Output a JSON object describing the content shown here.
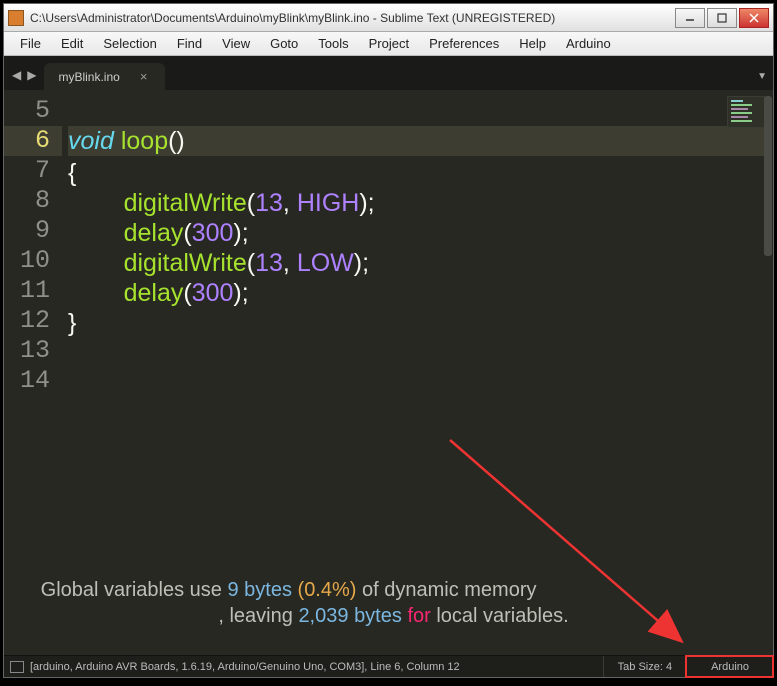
{
  "titlebar": {
    "path": "C:\\Users\\Administrator\\Documents\\Arduino\\myBlink\\myBlink.ino - Sublime Text (UNREGISTERED)"
  },
  "menu": [
    "File",
    "Edit",
    "Selection",
    "Find",
    "View",
    "Goto",
    "Tools",
    "Project",
    "Preferences",
    "Help",
    "Arduino"
  ],
  "tab": {
    "name": "myBlink.ino"
  },
  "lines": {
    "start": 5,
    "active": 6,
    "rows": [
      {
        "n": "5",
        "html": ""
      },
      {
        "n": "6",
        "html": "<span class='kw'>void</span> <span class='fn'>loop</span><span class='punct'>()</span>"
      },
      {
        "n": "7",
        "html": "<span class='punct'>{</span>"
      },
      {
        "n": "8",
        "html": "        <span class='fn'>digitalWrite</span><span class='punct'>(</span><span class='num'>13</span><span class='punct'>, </span><span class='const'>HIGH</span><span class='punct'>);</span>"
      },
      {
        "n": "9",
        "html": "        <span class='fn'>delay</span><span class='punct'>(</span><span class='num'>300</span><span class='punct'>);</span>"
      },
      {
        "n": "10",
        "html": "        <span class='fn'>digitalWrite</span><span class='punct'>(</span><span class='num'>13</span><span class='punct'>, </span><span class='const'>LOW</span><span class='punct'>);</span>"
      },
      {
        "n": "11",
        "html": "        <span class='fn'>delay</span><span class='punct'>(</span><span class='num'>300</span><span class='punct'>);</span>"
      },
      {
        "n": "12",
        "html": "<span class='punct'>}</span>"
      },
      {
        "n": "13",
        "html": ""
      },
      {
        "n": "14",
        "html": ""
      }
    ]
  },
  "build": {
    "line1_prefix": "Global variables use ",
    "line1_bytes": "9",
    "line1_bytes_word": "bytes",
    "line1_open": "(",
    "line1_pct": "0.4%",
    "line1_close": ")",
    "line1_mid": " of dynamic memory",
    "line2_prefix": ", leaving ",
    "line2_num": "2,039",
    "line2_bytes_word": "bytes",
    "line2_for": "for",
    "line2_rest": " local variables."
  },
  "status": {
    "left": "[arduino, Arduino AVR Boards, 1.6.19, Arduino/Genuino Uno, COM3], Line 6, Column 12",
    "tab_size": "Tab Size: 4",
    "syntax": "Arduino"
  }
}
